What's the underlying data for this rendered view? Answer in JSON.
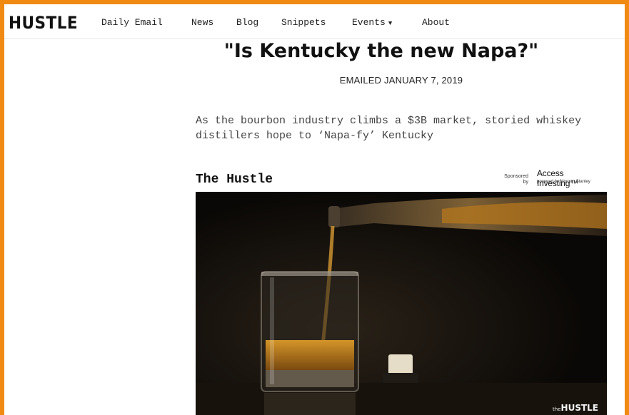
{
  "header": {
    "logo": "HUSTLE",
    "nav": [
      {
        "label": "Daily Email"
      },
      {
        "label": "News"
      },
      {
        "label": "Blog"
      },
      {
        "label": "Snippets"
      },
      {
        "label": "Events"
      },
      {
        "label": "About"
      }
    ]
  },
  "article": {
    "headline": "\"Is Kentucky the new Napa?\"",
    "emailed": "EMAILED JANUARY 7, 2019",
    "subtitle_line1": "As the bourbon industry climbs a $3B market, storied whiskey",
    "subtitle_line2": "distillers hope to ‘Napa-fy’ Kentucky",
    "brand": "The Hustle"
  },
  "sponsor": {
    "label_line1": "Sponsored",
    "label_line2": "by",
    "name": "Access Investing™",
    "powered": "powered by Morgan Stanley"
  },
  "video": {
    "watermark_prefix": "the",
    "watermark": "HUSTLE"
  },
  "colors": {
    "frame": "#f08a12",
    "whiskey": "#b8781a",
    "photo_bg": "#0d0b08"
  },
  "icons": {
    "events_caret": "caret-down-icon"
  }
}
